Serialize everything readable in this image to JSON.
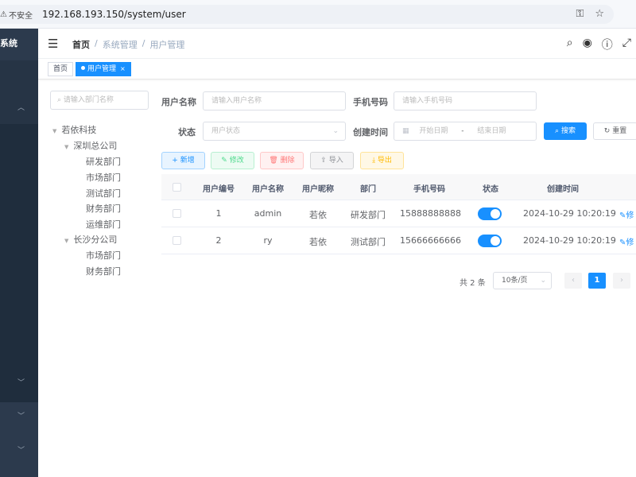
{
  "browser": {
    "security_label": "不安全",
    "url": "192.168.193.150/system/user"
  },
  "sidebar": {
    "brand": "系统"
  },
  "navbar": {
    "breadcrumbs": [
      "首页",
      "系统管理",
      "用户管理"
    ]
  },
  "tags": [
    {
      "label": "首页",
      "active": false
    },
    {
      "label": "用户管理",
      "active": true
    }
  ],
  "dept_search": {
    "placeholder": "请输入部门名称"
  },
  "tree": [
    {
      "label": "若依科技",
      "level": 0,
      "expandable": true
    },
    {
      "label": "深圳总公司",
      "level": 1,
      "expandable": true
    },
    {
      "label": "研发部门",
      "level": 2,
      "expandable": false
    },
    {
      "label": "市场部门",
      "level": 2,
      "expandable": false
    },
    {
      "label": "测试部门",
      "level": 2,
      "expandable": false
    },
    {
      "label": "财务部门",
      "level": 2,
      "expandable": false
    },
    {
      "label": "运维部门",
      "level": 2,
      "expandable": false
    },
    {
      "label": "长沙分公司",
      "level": 1,
      "expandable": true
    },
    {
      "label": "市场部门",
      "level": 2,
      "expandable": false
    },
    {
      "label": "财务部门",
      "level": 2,
      "expandable": false
    }
  ],
  "search_form": {
    "username_label": "用户名称",
    "username_placeholder": "请输入用户名称",
    "phone_label": "手机号码",
    "phone_placeholder": "请输入手机号码",
    "status_label": "状态",
    "status_placeholder": "用户状态",
    "created_label": "创建时间",
    "start_placeholder": "开始日期",
    "date_separator": "-",
    "end_placeholder": "结束日期",
    "search_button": "搜索",
    "reset_button": "重置"
  },
  "toolbar": {
    "add": "新增",
    "edit": "修改",
    "delete": "删除",
    "import": "导入",
    "export": "导出"
  },
  "table": {
    "headers": [
      "用户编号",
      "用户名称",
      "用户昵称",
      "部门",
      "手机号码",
      "状态",
      "创建时间"
    ],
    "rows": [
      {
        "id": "1",
        "username": "admin",
        "nickname": "若依",
        "dept": "研发部门",
        "phone": "15888888888",
        "status_on": true,
        "created": "2024-10-29 10:20:19",
        "action": "修"
      },
      {
        "id": "2",
        "username": "ry",
        "nickname": "若依",
        "dept": "测试部门",
        "phone": "15666666666",
        "status_on": true,
        "created": "2024-10-29 10:20:19",
        "action": "修"
      }
    ]
  },
  "pagination": {
    "total": "共 2 条",
    "page_size": "10条/页",
    "current_page": "1"
  },
  "colors": {
    "primary": "#1890ff",
    "sidebar": "#2c3a4d"
  }
}
